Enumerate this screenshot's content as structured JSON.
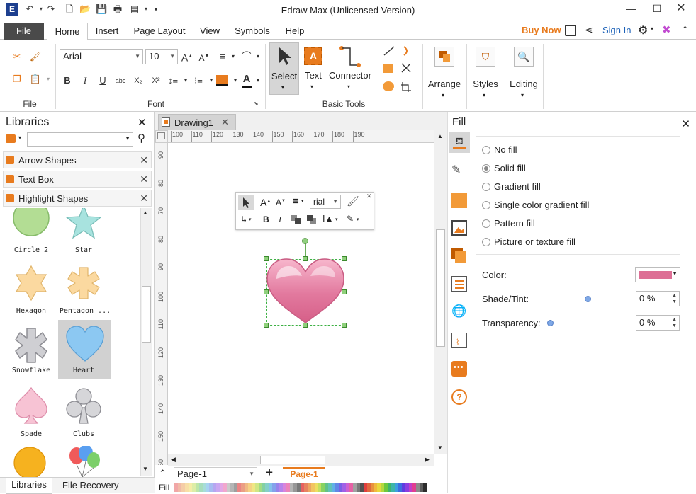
{
  "window": {
    "title": "Edraw Max (Unlicensed Version)"
  },
  "menu": {
    "file": "File",
    "tabs": [
      "Home",
      "Insert",
      "Page Layout",
      "View",
      "Symbols",
      "Help"
    ],
    "buy_now": "Buy Now",
    "sign_in": "Sign In"
  },
  "ribbon": {
    "groups": {
      "file": "File",
      "font": "Font",
      "basic_tools": "Basic Tools"
    },
    "font_name": "Arial",
    "font_size": "10",
    "select": "Select",
    "text": "Text",
    "connector": "Connector",
    "arrange": "Arrange",
    "styles": "Styles",
    "editing": "Editing"
  },
  "libraries": {
    "title": "Libraries",
    "rows": [
      "Arrow Shapes",
      "Text Box",
      "Highlight Shapes"
    ],
    "shapes": [
      "Circle 2",
      "Star",
      "Hexagon",
      "Pentagon ...",
      "Snowflake",
      "Heart",
      "Spade",
      "Clubs"
    ],
    "bottom_tabs": [
      "Libraries",
      "File Recovery"
    ]
  },
  "document": {
    "tab": "Drawing1",
    "ruler_h": [
      "100",
      "110",
      "120",
      "130",
      "140",
      "150",
      "160",
      "170",
      "180",
      "190"
    ],
    "ruler_v": [
      "90",
      "80",
      "70",
      "80",
      "90",
      "100",
      "110",
      "120",
      "130",
      "140",
      "150",
      "160"
    ],
    "mini_font": "rial",
    "page_select": "Page-1",
    "page_tab": "Page-1",
    "fill_label": "Fill"
  },
  "fill_panel": {
    "title": "Fill",
    "options": [
      "No fill",
      "Solid fill",
      "Gradient fill",
      "Single color gradient fill",
      "Pattern fill",
      "Picture or texture fill"
    ],
    "selected": "Solid fill",
    "color_label": "Color:",
    "color_value": "#dd6f95",
    "shade_label": "Shade/Tint:",
    "shade_value": "0 %",
    "shade_level": 0.5,
    "transparency_label": "Transparency:",
    "transparency_value": "0 %",
    "transparency_level": 0
  },
  "colors": {
    "accent": "#e87b1e",
    "link": "#1d62b8",
    "file_tab": "#4a4a4a"
  }
}
